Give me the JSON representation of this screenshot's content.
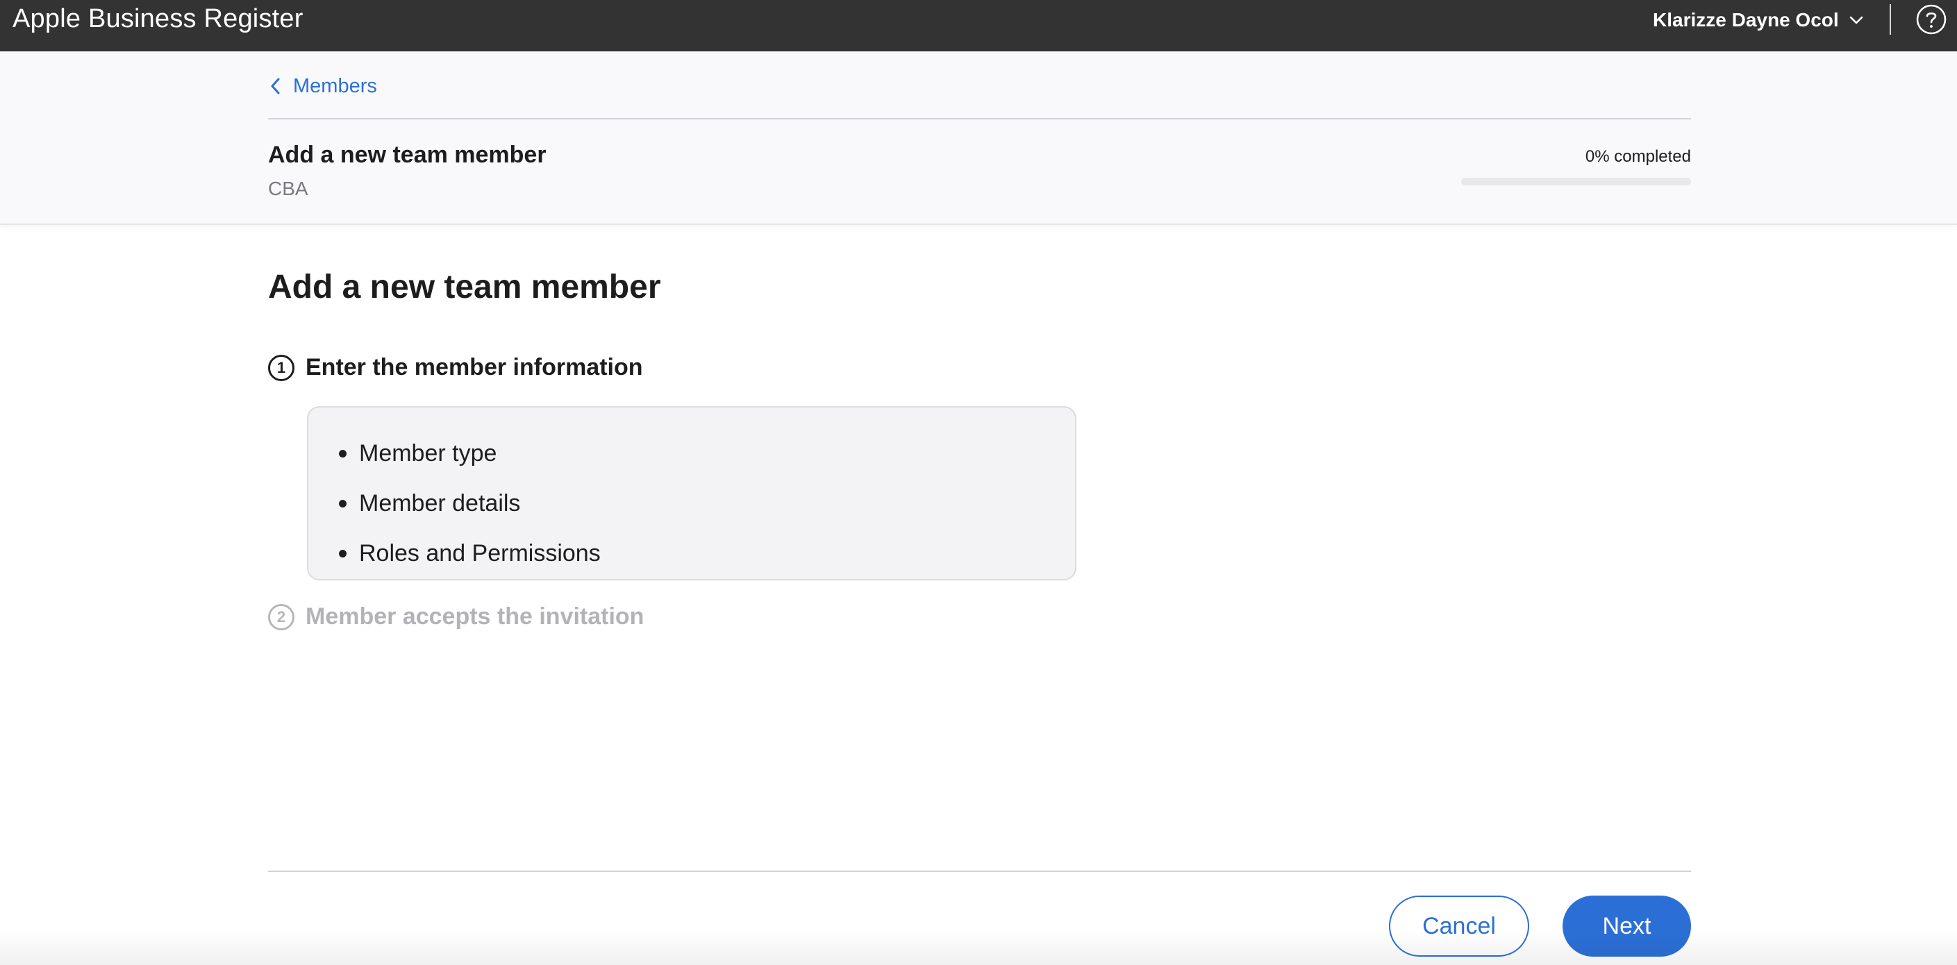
{
  "app": {
    "title": "Apple Business Register"
  },
  "header": {
    "user_name": "Klarizze Dayne Ocol",
    "icons": {
      "user_menu": "chevron-down-icon",
      "help": "help-circle-icon"
    }
  },
  "subheader": {
    "breadcrumb": "Members",
    "title": "Add a new team member",
    "organization": "CBA",
    "progress_label": "0% completed",
    "progress_fraction": 0
  },
  "main": {
    "heading": "Add a new team member",
    "steps": [
      {
        "number": "1",
        "label": "Enter the member information",
        "state": "active",
        "items": [
          "Member type",
          "Member details",
          "Roles and Permissions"
        ]
      },
      {
        "number": "2",
        "label": "Member accepts the invitation",
        "state": "inactive"
      }
    ]
  },
  "footer": {
    "cancel_label": "Cancel",
    "next_label": "Next"
  },
  "colors": {
    "accent": "#2b6fd6",
    "topbar": "#333333",
    "subheader_bg": "#f9f9fb",
    "info_box_bg": "#f3f3f5"
  }
}
